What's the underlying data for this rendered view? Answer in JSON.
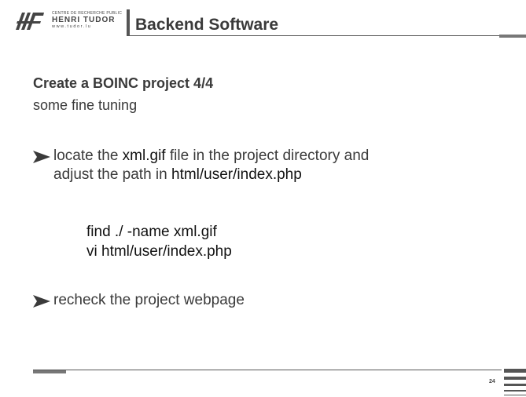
{
  "header": {
    "logo": {
      "small_text": "CENTRE DE RECHERCHE PUBLIC",
      "name": "HENRI TUDOR",
      "url": "www.tudor.lu"
    },
    "title": "Backend Software"
  },
  "content": {
    "heading": "Create a BOINC project 4/4",
    "subheading": "some fine tuning",
    "bullet1": {
      "part1": "locate the ",
      "highlight1": "xml.gif",
      "part2": " file in the project directory and",
      "part3": "adjust the path in ",
      "highlight2": "html/user/index.php"
    },
    "commands": [
      "find ./ -name xml.gif",
      "vi html/user/index.php"
    ],
    "bullet2": "recheck the project webpage"
  },
  "footer": {
    "page_number": "24"
  }
}
